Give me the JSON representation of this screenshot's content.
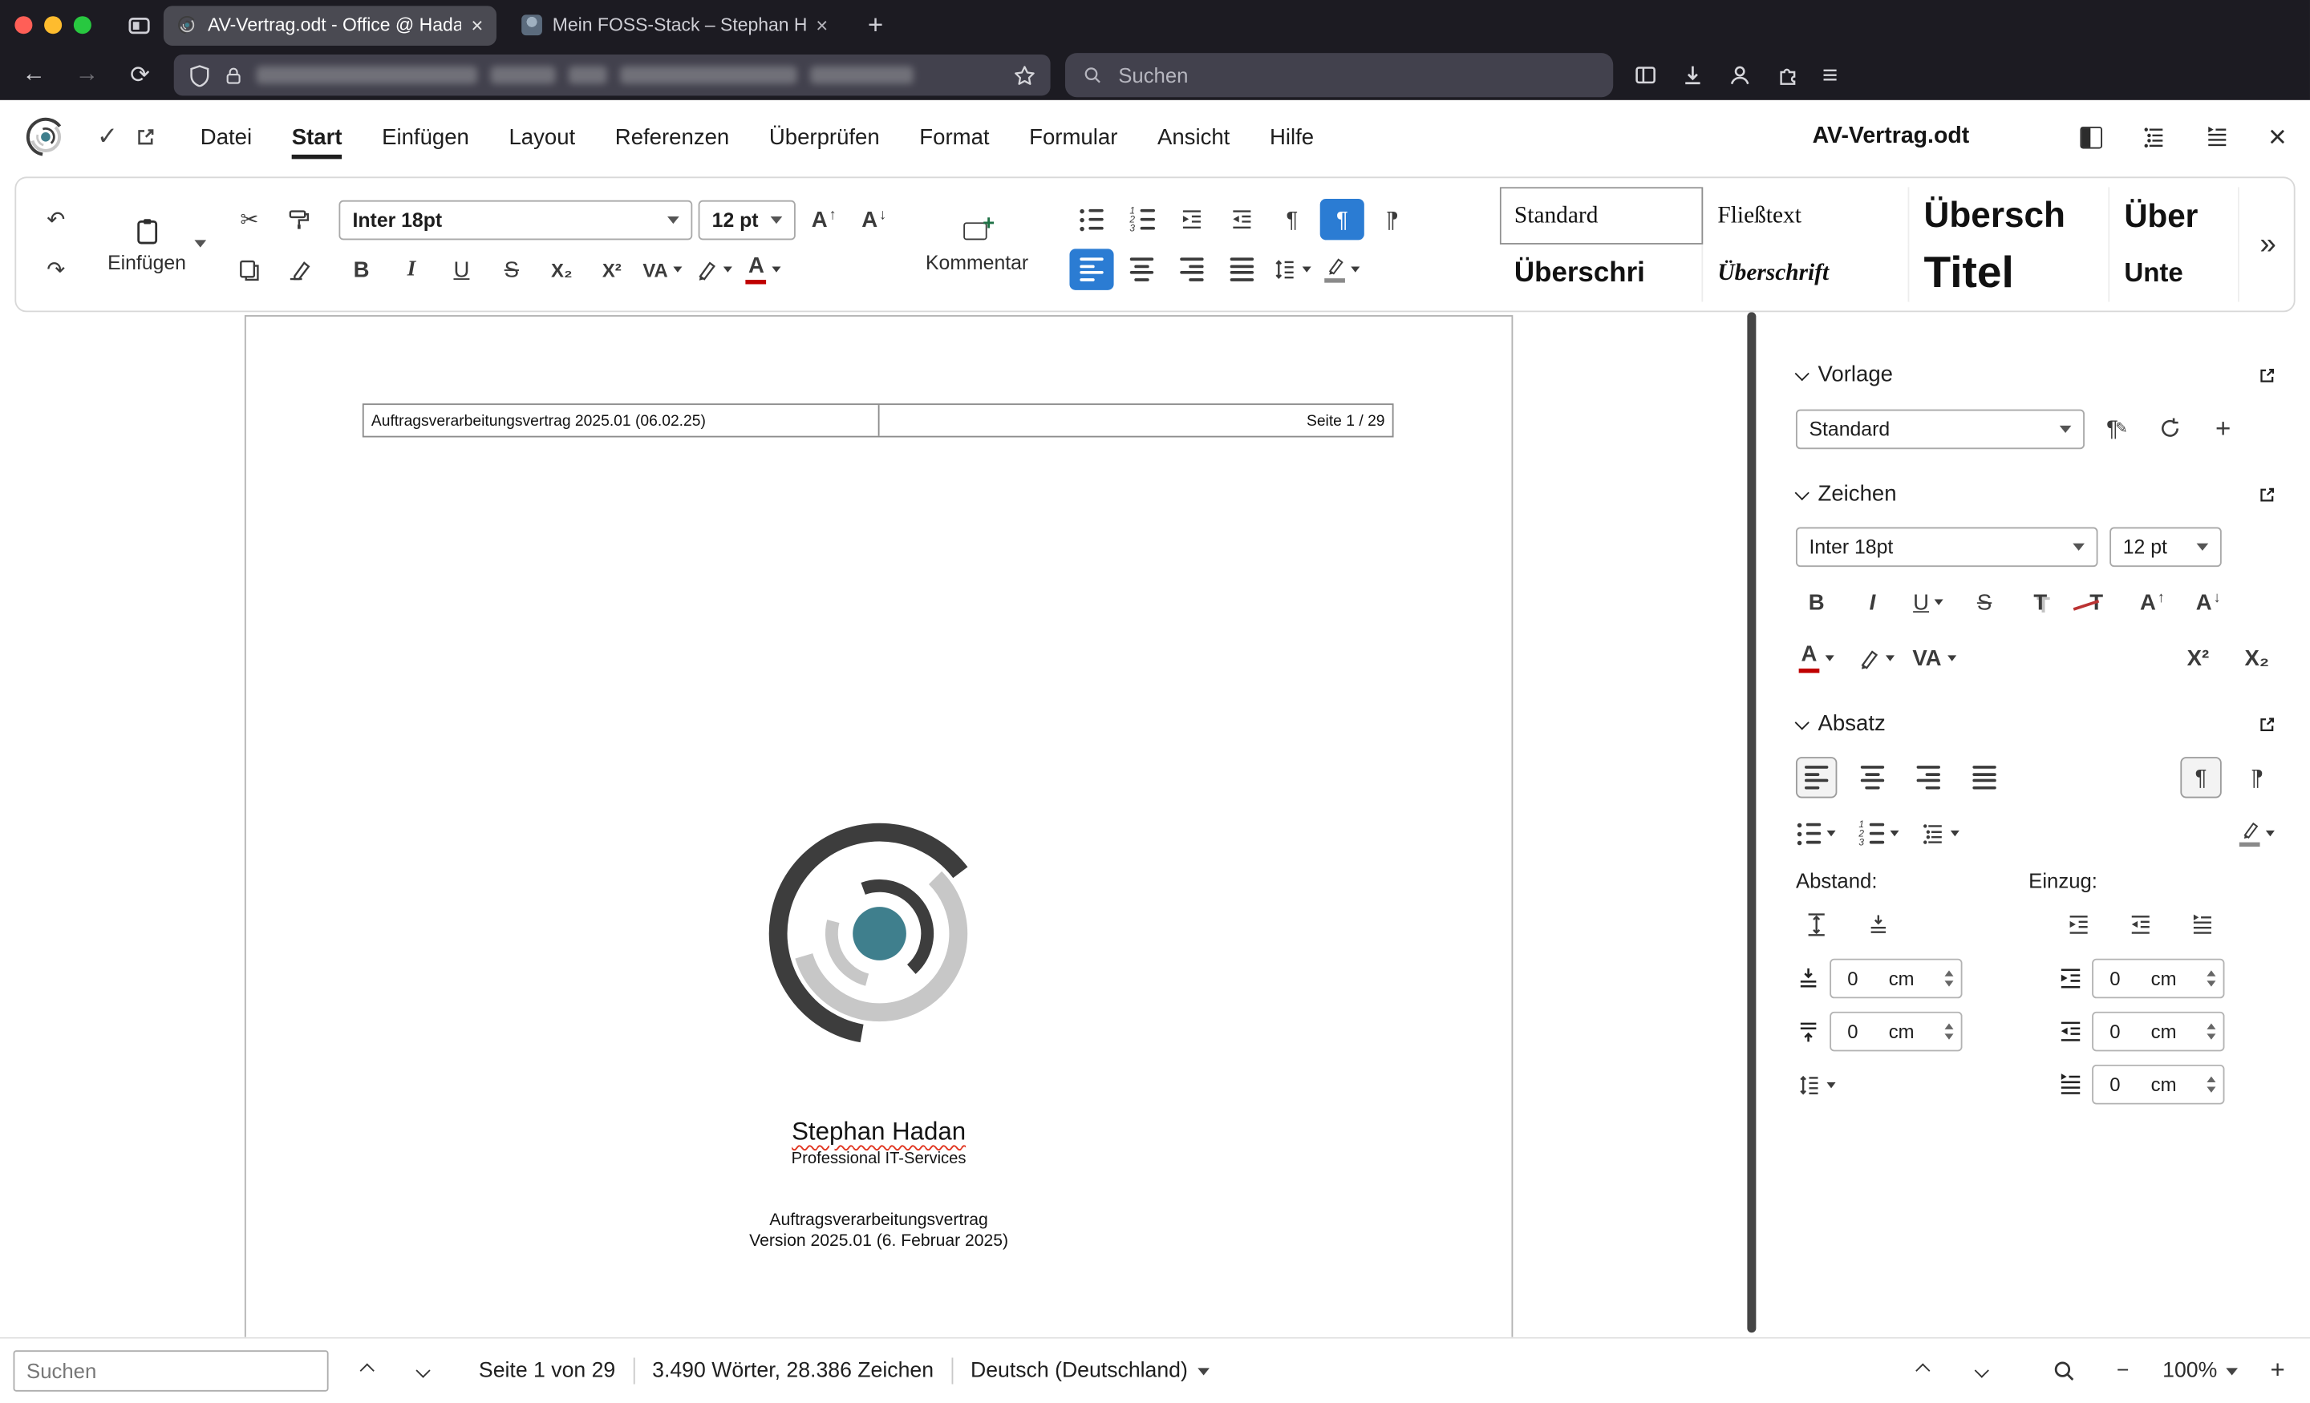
{
  "colors": {
    "accent_blue": "#2b7cd3",
    "logo_teal": "#3f7f8d",
    "comment_green": "#1e7145",
    "spell_red": "#e0341f",
    "chrome_bg": "#1c1b22"
  },
  "browser": {
    "tab1_title": "AV-Vertrag.odt - Office @ Hada",
    "tab2_title": "Mein FOSS-Stack – Stephan Ha",
    "search_placeholder": "Suchen"
  },
  "menu": {
    "items": [
      {
        "label": "Datei"
      },
      {
        "label": "Start"
      },
      {
        "label": "Einfügen"
      },
      {
        "label": "Layout"
      },
      {
        "label": "Referenzen"
      },
      {
        "label": "Überprüfen"
      },
      {
        "label": "Format"
      },
      {
        "label": "Formular"
      },
      {
        "label": "Ansicht"
      },
      {
        "label": "Hilfe"
      }
    ],
    "doc_title": "AV-Vertrag.odt"
  },
  "toolbar": {
    "paste_label": "Einfügen",
    "comment_label": "Kommentar",
    "font_name": "Inter 18pt",
    "font_size": "12 pt",
    "styles": [
      {
        "label": "Standard"
      },
      {
        "label": "Fließtext"
      },
      {
        "label": "Übersch"
      },
      {
        "label": "Über"
      },
      {
        "label": "Überschri"
      },
      {
        "label": "Überschrift"
      },
      {
        "label": "Titel"
      },
      {
        "label": "Unte"
      }
    ]
  },
  "sidebar": {
    "vorlage_title": "Vorlage",
    "style_value": "Standard",
    "zeichen_title": "Zeichen",
    "font_name": "Inter 18pt",
    "font_size": "12 pt",
    "absatz_title": "Absatz",
    "abstand_label": "Abstand:",
    "einzug_label": "Einzug:",
    "spacing_above": {
      "value": "0",
      "unit": "cm"
    },
    "spacing_below": {
      "value": "0",
      "unit": "cm"
    },
    "indent_before": {
      "value": "0",
      "unit": "cm"
    },
    "indent_after": {
      "value": "0",
      "unit": "cm"
    },
    "indent_first": {
      "value": "0",
      "unit": "cm"
    }
  },
  "document": {
    "header_left": "Auftragsverarbeitungsvertrag 2025.01 (06.02.25)",
    "header_right": "Seite 1 / 29",
    "name": "Stephan Hadan",
    "subtitle": "Professional IT-Services",
    "line1": "Auftragsverarbeitungsvertrag",
    "line2": "Version 2025.01 (6. Februar 2025)"
  },
  "statusbar": {
    "search_placeholder": "Suchen",
    "page_info": "Seite 1 von 29",
    "word_count": "3.490 Wörter, 28.386 Zeichen",
    "language": "Deutsch (Deutschland)",
    "zoom_level": "100%"
  },
  "icons": {
    "undo": "↶",
    "redo": "↷",
    "cut": "✂",
    "pilcrow": "¶",
    "bold": "B",
    "italic": "I",
    "underline": "U",
    "strike": "S",
    "superscript": "X²",
    "subscript": "X₂",
    "char_spacing": "VA",
    "font_color": "A",
    "shadow": "T",
    "clear_format": "T",
    "grow_letter": "A",
    "arrow_up": "↑",
    "arrow_down": "↓",
    "more": "»",
    "plus": "+",
    "close": "×",
    "check": "✓",
    "back": "←",
    "forward": "→",
    "reload": "⟳",
    "menu": "≡",
    "minus": "−",
    "pen": "✎",
    "updown": "↕"
  }
}
